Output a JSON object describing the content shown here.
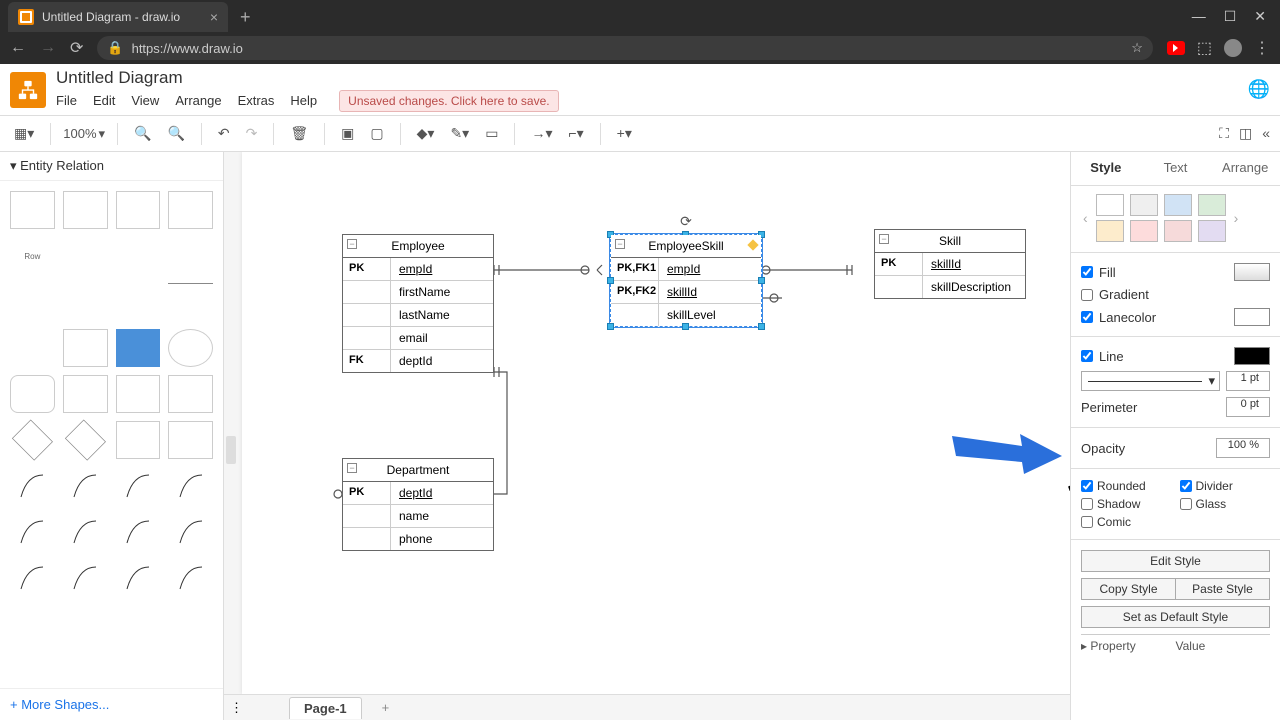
{
  "browser": {
    "tab_title": "Untitled Diagram - draw.io",
    "url": "https://www.draw.io",
    "close": "×",
    "newtab": "+",
    "wc_min": "—",
    "wc_max": "☐",
    "wc_close": "✕",
    "back": "←",
    "fwd": "→",
    "reload": "⟳",
    "lock": "🔒",
    "star": "☆",
    "menu": "⋮"
  },
  "app": {
    "title": "Untitled Diagram",
    "menus": [
      "File",
      "Edit",
      "View",
      "Arrange",
      "Extras",
      "Help"
    ],
    "save_warning": "Unsaved changes. Click here to save.",
    "globe": "🌐"
  },
  "toolbar": {
    "zoom": "100%"
  },
  "sidebar": {
    "section": "Entity Relation",
    "row_label": "Row",
    "more": "+ More Shapes..."
  },
  "canvas": {
    "tables": {
      "employee": {
        "title": "Employee",
        "rows": [
          {
            "key": "PK",
            "val": "empId",
            "u": true
          },
          {
            "key": "",
            "val": "firstName"
          },
          {
            "key": "",
            "val": "lastName"
          },
          {
            "key": "",
            "val": "email"
          },
          {
            "key": "FK",
            "val": "deptId"
          }
        ]
      },
      "employeeskill": {
        "title": "EmployeeSkill",
        "rows": [
          {
            "key": "PK,FK1",
            "val": "empId",
            "u": true
          },
          {
            "key": "PK,FK2",
            "val": "skillId",
            "u": true
          },
          {
            "key": "",
            "val": "skillLevel"
          }
        ]
      },
      "skill": {
        "title": "Skill",
        "rows": [
          {
            "key": "PK",
            "val": "skillId",
            "u": true
          },
          {
            "key": "",
            "val": "skillDescription"
          }
        ]
      },
      "department": {
        "title": "Department",
        "rows": [
          {
            "key": "PK",
            "val": "deptId",
            "u": true
          },
          {
            "key": "",
            "val": "name"
          },
          {
            "key": "",
            "val": "phone"
          }
        ]
      }
    },
    "page": "Page-1"
  },
  "style_panel": {
    "tabs": [
      "Style",
      "Text",
      "Arrange"
    ],
    "swatches_row1": [
      "#ffffff",
      "#efefef",
      "#d1e3f5",
      "#d9ecd9"
    ],
    "swatches_row2": [
      "#fdeccc",
      "#fddcdc",
      "#f6dada",
      "#e3dcf2"
    ],
    "fill": {
      "label": "Fill",
      "checked": true,
      "color": "#ffffff"
    },
    "gradient": {
      "label": "Gradient",
      "checked": false
    },
    "lanecolor": {
      "label": "Lanecolor",
      "checked": true,
      "color": "#ffffff"
    },
    "line": {
      "label": "Line",
      "checked": true,
      "color": "#000000",
      "width": "1 pt"
    },
    "perimeter": {
      "label": "Perimeter",
      "value": "0 pt"
    },
    "opacity": {
      "label": "Opacity",
      "value": "100 %"
    },
    "rounded": {
      "label": "Rounded",
      "checked": true
    },
    "divider": {
      "label": "Divider",
      "checked": true
    },
    "shadow": {
      "label": "Shadow",
      "checked": false
    },
    "glass": {
      "label": "Glass",
      "checked": false
    },
    "comic": {
      "label": "Comic",
      "checked": false
    },
    "edit_style": "Edit Style",
    "copy_style": "Copy Style",
    "paste_style": "Paste Style",
    "default_style": "Set as Default Style",
    "property": "Property",
    "value": "Value"
  }
}
